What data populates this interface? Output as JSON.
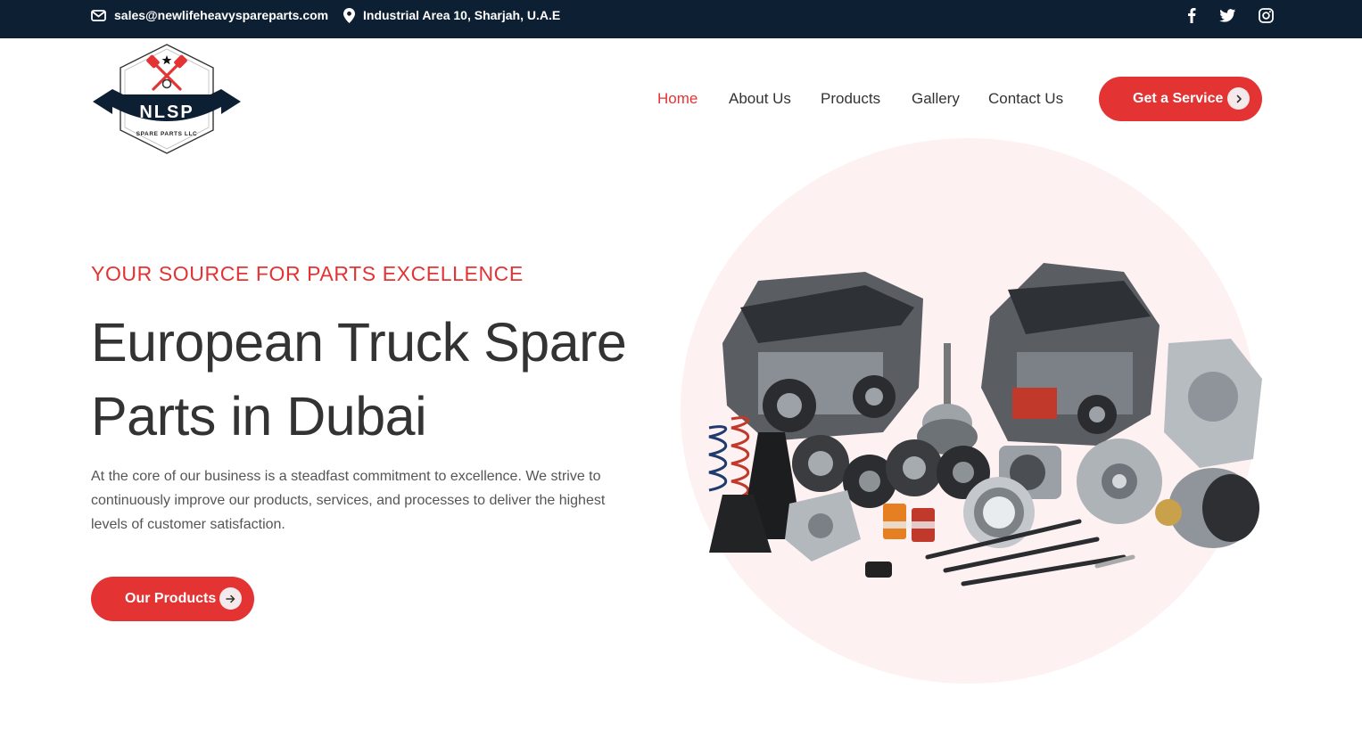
{
  "topbar": {
    "email": "sales@newlifeheavyspareparts.com",
    "address": "Industrial Area 10, Sharjah, U.A.E",
    "social": [
      "facebook-icon",
      "twitter-icon",
      "instagram-icon"
    ]
  },
  "logo": {
    "text": "NLSP",
    "subtext": "SPARE PARTS LLC"
  },
  "nav": {
    "home": "Home",
    "about": "About Us",
    "products": "Products",
    "gallery": "Gallery",
    "contact": "Contact Us",
    "active": "Home"
  },
  "header": {
    "cta": "Get a Service"
  },
  "hero": {
    "eyebrow": "YOUR SOURCE FOR PARTS EXCELLENCE",
    "title": "European Truck Spare Parts in Dubai",
    "text": "At the core of our business is a steadfast commitment to excellence. We strive to continuously improve our products, services, and processes to deliver the highest levels of customer satisfaction.",
    "button": "Our Products"
  },
  "colors": {
    "accent": "#e43333",
    "topbar": "#0d1f33",
    "circle": "#fdf1f1"
  }
}
